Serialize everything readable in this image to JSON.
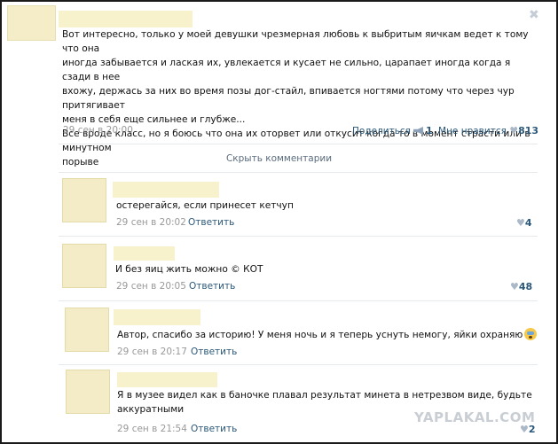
{
  "post": {
    "close_icon": "close-icon",
    "text_lines": [
      "Вот интересно, только у моей девушки чрезмерная любовь к выбритым яичкам ведет к тому что она",
      "иногда забывается и лаская их, увлекается и кусает не сильно, царапает иногда когда я сзади в нее",
      "вхожу, держась за них во время позы дог-стайл, впивается ногтями потому что через чур притягивает",
      "меня в себя еще сильнее и глубже...",
      "Все вроде класс, но я боюсь что она их оторвет или откусит когда то в момент страсти или в минутном",
      "порыве"
    ],
    "date": "29 сен в 20:00",
    "share_label": "Поделиться",
    "share_count": "1",
    "like_label": "Мне нравится",
    "like_count": "813"
  },
  "hide_comments_label": "Скрыть комментарии",
  "comments": [
    {
      "text": "остерегайся, если принесет кетчуп",
      "date": "29 сен в 20:02",
      "reply_label": "Ответить",
      "likes": "4"
    },
    {
      "text": "И без яиц жить можно © КОТ",
      "date": "29 сен в 20:05",
      "reply_label": "Ответить",
      "likes": "48"
    },
    {
      "text": "Автор, спасибо за историю! У меня ночь и я теперь уснуть немогу, яйки охраняю",
      "date": "29 сен в 20:17",
      "reply_label": "Ответить",
      "likes": ""
    },
    {
      "text_lines": [
        "Я в музее видел как в баночке плавал результат минета в нетрезвом виде, будьте",
        "аккуратными"
      ],
      "date": "29 сен в 21:54",
      "reply_label": "Ответить",
      "likes": "2"
    }
  ],
  "watermark": "YAPLAKAL.COM",
  "colors": {
    "link": "#2b587a",
    "meta": "#999999",
    "placeholder": "#f7f1cc",
    "frame": "#1a1a1a"
  }
}
